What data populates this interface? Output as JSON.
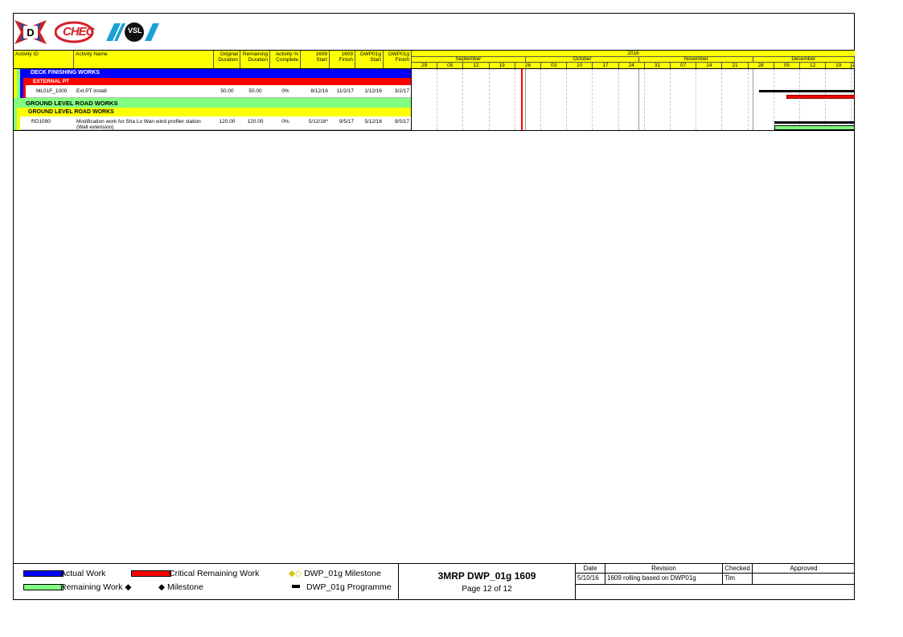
{
  "header": {
    "logos": [
      "D",
      "CHEC",
      "VSL"
    ],
    "columns": {
      "activity_id": "Activity ID",
      "activity_name": "Activity Name",
      "orig_dur": [
        "Original",
        "Duration"
      ],
      "rem_dur": [
        "Remaining",
        "Duration"
      ],
      "pct": [
        "Activity %",
        "Complete"
      ],
      "start_1609": [
        "1609",
        "Start"
      ],
      "finish_1609": [
        "1609",
        "Finish"
      ],
      "start_dwp": [
        "DWP01g",
        "Start"
      ],
      "finish_dwp": [
        "DWP01g",
        "Finish"
      ]
    },
    "timeline": {
      "year": "2016",
      "months": [
        "September",
        "October",
        "November",
        "December"
      ],
      "weeks": [
        "29",
        "05",
        "12",
        "19",
        "26",
        "03",
        "10",
        "17",
        "24",
        "31",
        "07",
        "14",
        "21",
        "28",
        "05",
        "12",
        "19",
        "2"
      ]
    }
  },
  "rows": {
    "deck": "DECK FINISHING WORKS",
    "external_pt": "EXTERNAL PT",
    "a1": {
      "id": "ML01F_1000",
      "name": "Ext.PT install",
      "orig": "50.00",
      "rem": "50.00",
      "pct": "0%",
      "s1609": "8/12/16",
      "f1609": "11/2/17",
      "sdwp": "1/12/16",
      "fdwp": "3/2/17"
    },
    "ground1": "GROUND LEVEL ROAD WORKS",
    "ground2": "GROUND LEVEL ROAD WORKS",
    "a2": {
      "id": "RD1090",
      "name1": "Modification work for Sha Lo Wan wind profiler station",
      "name2": "(Wall extension)",
      "orig": "120.00",
      "rem": "120.00",
      "pct": "0%",
      "s1609": "5/12/16*",
      "f1609": "9/5/17",
      "sdwp": "5/12/16",
      "fdwp": "9/5/17"
    }
  },
  "legend": {
    "actual": "Actual Work",
    "critical": "Critical Remaining Work",
    "dwp_milestone": "DWP_01g Milestone",
    "remaining": "Remaining Work",
    "milestone": "Milestone",
    "dwp_programme": "DWP_01g Programme"
  },
  "title_block": {
    "title": "3MRP DWP_01g 1609",
    "page": "Page 12 of 12"
  },
  "revision": {
    "headers": {
      "date": "Date",
      "revision": "Revision",
      "checked": "Checked",
      "approved": "Approved"
    },
    "row": {
      "date": "5/10/16",
      "revision": "1609 rolling based on DWP01g",
      "checked": "Tim",
      "approved": ""
    }
  },
  "colors": {
    "blue": "#0000ff",
    "red": "#ff0000",
    "green": "#80ff80",
    "yellow": "#ffff00",
    "data_date": "#ff0000"
  }
}
